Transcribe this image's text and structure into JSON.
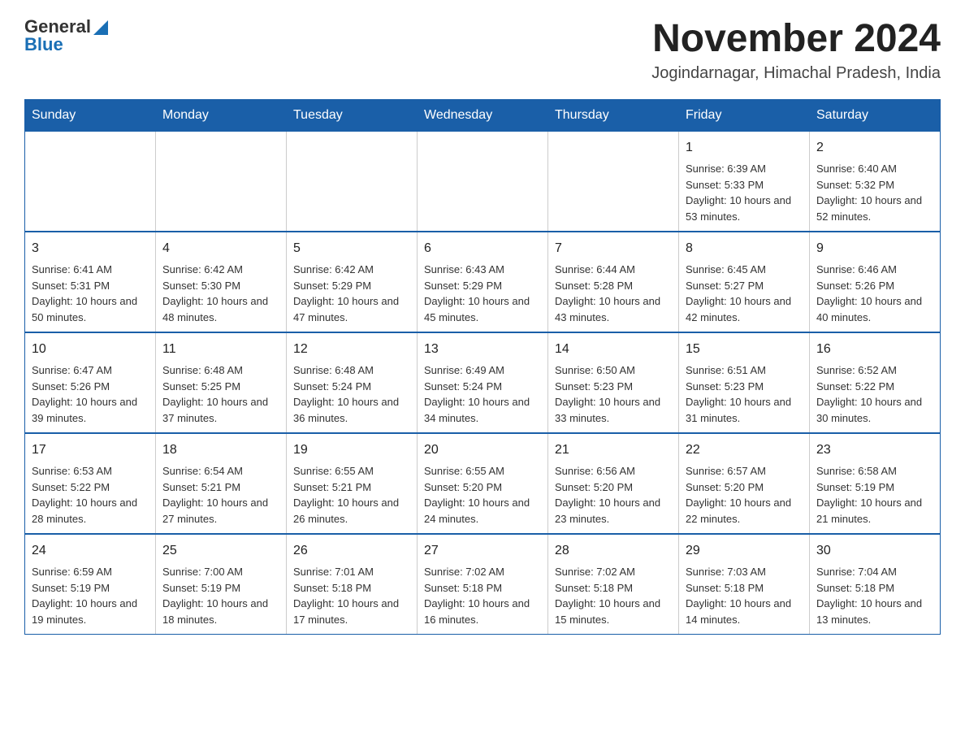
{
  "header": {
    "logo": {
      "general": "General",
      "blue": "Blue"
    },
    "title": "November 2024",
    "location": "Jogindarnagar, Himachal Pradesh, India"
  },
  "days_of_week": [
    "Sunday",
    "Monday",
    "Tuesday",
    "Wednesday",
    "Thursday",
    "Friday",
    "Saturday"
  ],
  "weeks": [
    [
      {
        "day": "",
        "info": ""
      },
      {
        "day": "",
        "info": ""
      },
      {
        "day": "",
        "info": ""
      },
      {
        "day": "",
        "info": ""
      },
      {
        "day": "",
        "info": ""
      },
      {
        "day": "1",
        "info": "Sunrise: 6:39 AM\nSunset: 5:33 PM\nDaylight: 10 hours and 53 minutes."
      },
      {
        "day": "2",
        "info": "Sunrise: 6:40 AM\nSunset: 5:32 PM\nDaylight: 10 hours and 52 minutes."
      }
    ],
    [
      {
        "day": "3",
        "info": "Sunrise: 6:41 AM\nSunset: 5:31 PM\nDaylight: 10 hours and 50 minutes."
      },
      {
        "day": "4",
        "info": "Sunrise: 6:42 AM\nSunset: 5:30 PM\nDaylight: 10 hours and 48 minutes."
      },
      {
        "day": "5",
        "info": "Sunrise: 6:42 AM\nSunset: 5:29 PM\nDaylight: 10 hours and 47 minutes."
      },
      {
        "day": "6",
        "info": "Sunrise: 6:43 AM\nSunset: 5:29 PM\nDaylight: 10 hours and 45 minutes."
      },
      {
        "day": "7",
        "info": "Sunrise: 6:44 AM\nSunset: 5:28 PM\nDaylight: 10 hours and 43 minutes."
      },
      {
        "day": "8",
        "info": "Sunrise: 6:45 AM\nSunset: 5:27 PM\nDaylight: 10 hours and 42 minutes."
      },
      {
        "day": "9",
        "info": "Sunrise: 6:46 AM\nSunset: 5:26 PM\nDaylight: 10 hours and 40 minutes."
      }
    ],
    [
      {
        "day": "10",
        "info": "Sunrise: 6:47 AM\nSunset: 5:26 PM\nDaylight: 10 hours and 39 minutes."
      },
      {
        "day": "11",
        "info": "Sunrise: 6:48 AM\nSunset: 5:25 PM\nDaylight: 10 hours and 37 minutes."
      },
      {
        "day": "12",
        "info": "Sunrise: 6:48 AM\nSunset: 5:24 PM\nDaylight: 10 hours and 36 minutes."
      },
      {
        "day": "13",
        "info": "Sunrise: 6:49 AM\nSunset: 5:24 PM\nDaylight: 10 hours and 34 minutes."
      },
      {
        "day": "14",
        "info": "Sunrise: 6:50 AM\nSunset: 5:23 PM\nDaylight: 10 hours and 33 minutes."
      },
      {
        "day": "15",
        "info": "Sunrise: 6:51 AM\nSunset: 5:23 PM\nDaylight: 10 hours and 31 minutes."
      },
      {
        "day": "16",
        "info": "Sunrise: 6:52 AM\nSunset: 5:22 PM\nDaylight: 10 hours and 30 minutes."
      }
    ],
    [
      {
        "day": "17",
        "info": "Sunrise: 6:53 AM\nSunset: 5:22 PM\nDaylight: 10 hours and 28 minutes."
      },
      {
        "day": "18",
        "info": "Sunrise: 6:54 AM\nSunset: 5:21 PM\nDaylight: 10 hours and 27 minutes."
      },
      {
        "day": "19",
        "info": "Sunrise: 6:55 AM\nSunset: 5:21 PM\nDaylight: 10 hours and 26 minutes."
      },
      {
        "day": "20",
        "info": "Sunrise: 6:55 AM\nSunset: 5:20 PM\nDaylight: 10 hours and 24 minutes."
      },
      {
        "day": "21",
        "info": "Sunrise: 6:56 AM\nSunset: 5:20 PM\nDaylight: 10 hours and 23 minutes."
      },
      {
        "day": "22",
        "info": "Sunrise: 6:57 AM\nSunset: 5:20 PM\nDaylight: 10 hours and 22 minutes."
      },
      {
        "day": "23",
        "info": "Sunrise: 6:58 AM\nSunset: 5:19 PM\nDaylight: 10 hours and 21 minutes."
      }
    ],
    [
      {
        "day": "24",
        "info": "Sunrise: 6:59 AM\nSunset: 5:19 PM\nDaylight: 10 hours and 19 minutes."
      },
      {
        "day": "25",
        "info": "Sunrise: 7:00 AM\nSunset: 5:19 PM\nDaylight: 10 hours and 18 minutes."
      },
      {
        "day": "26",
        "info": "Sunrise: 7:01 AM\nSunset: 5:18 PM\nDaylight: 10 hours and 17 minutes."
      },
      {
        "day": "27",
        "info": "Sunrise: 7:02 AM\nSunset: 5:18 PM\nDaylight: 10 hours and 16 minutes."
      },
      {
        "day": "28",
        "info": "Sunrise: 7:02 AM\nSunset: 5:18 PM\nDaylight: 10 hours and 15 minutes."
      },
      {
        "day": "29",
        "info": "Sunrise: 7:03 AM\nSunset: 5:18 PM\nDaylight: 10 hours and 14 minutes."
      },
      {
        "day": "30",
        "info": "Sunrise: 7:04 AM\nSunset: 5:18 PM\nDaylight: 10 hours and 13 minutes."
      }
    ]
  ]
}
